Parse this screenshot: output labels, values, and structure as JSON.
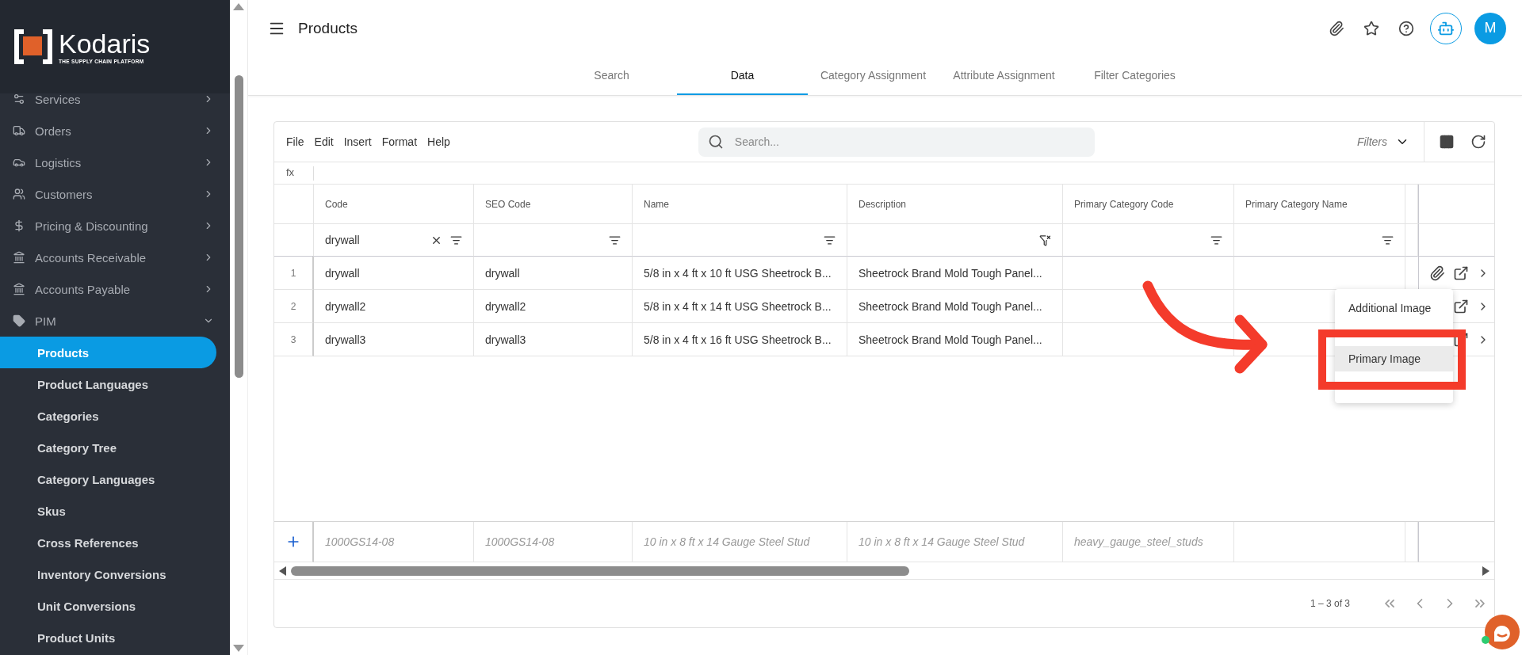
{
  "sidebar": {
    "logo": {
      "name": "Kodaris",
      "tagline": "THE SUPPLY CHAIN PLATFORM"
    },
    "items": [
      {
        "label": "Services",
        "expanded": false
      },
      {
        "label": "Orders",
        "expanded": false
      },
      {
        "label": "Logistics",
        "expanded": false
      },
      {
        "label": "Customers",
        "expanded": false
      },
      {
        "label": "Pricing & Discounting",
        "expanded": false
      },
      {
        "label": "Accounts Receivable",
        "expanded": false
      },
      {
        "label": "Accounts Payable",
        "expanded": false
      },
      {
        "label": "PIM",
        "expanded": true,
        "children": [
          {
            "label": "Products",
            "selected": true
          },
          {
            "label": "Product Languages",
            "selected": false
          },
          {
            "label": "Categories",
            "selected": false
          },
          {
            "label": "Category Tree",
            "selected": false
          },
          {
            "label": "Category Languages",
            "selected": false
          },
          {
            "label": "Skus",
            "selected": false
          },
          {
            "label": "Cross References",
            "selected": false
          },
          {
            "label": "Inventory Conversions",
            "selected": false
          },
          {
            "label": "Unit Conversions",
            "selected": false
          },
          {
            "label": "Product Units",
            "selected": false
          }
        ]
      }
    ]
  },
  "header": {
    "title": "Products",
    "avatar": "M"
  },
  "tabs": [
    {
      "label": "Search",
      "selected": false
    },
    {
      "label": "Data",
      "selected": true
    },
    {
      "label": "Category Assignment",
      "selected": false
    },
    {
      "label": "Attribute Assignment",
      "selected": false
    },
    {
      "label": "Filter Categories",
      "selected": false
    }
  ],
  "menu_bar": [
    "File",
    "Edit",
    "Insert",
    "Format",
    "Help"
  ],
  "search": {
    "placeholder": "Search..."
  },
  "filters_label": "Filters",
  "formula_label": "fx",
  "table": {
    "columns": [
      {
        "label": "Code",
        "filter": "drywall",
        "filter_disabled": false
      },
      {
        "label": "SEO Code",
        "filter_disabled": false
      },
      {
        "label": "Name",
        "filter_disabled": false
      },
      {
        "label": "Description",
        "filter_disabled": true
      },
      {
        "label": "Primary Category Code",
        "filter_disabled": false
      },
      {
        "label": "Primary Category Name",
        "filter_disabled": false
      }
    ],
    "rows": [
      {
        "number": "1",
        "attachment": true,
        "cells": [
          "drywall",
          "drywall",
          "5/8 in x 4 ft x 10 ft USG Sheetrock B...",
          "Sheetrock Brand Mold Tough Panel..."
        ]
      },
      {
        "number": "2",
        "cells": [
          "drywall2",
          "drywall2",
          "5/8 in x 4 ft x 14 ft USG Sheetrock B...",
          "Sheetrock Brand Mold Tough Panel..."
        ]
      },
      {
        "number": "3",
        "cells": [
          "drywall3",
          "drywall3",
          "5/8 in x 4 ft x 16 ft USG Sheetrock B...",
          "Sheetrock Brand Mold Tough Panel..."
        ]
      }
    ],
    "new_row": {
      "cells": [
        "1000GS14-08",
        "1000GS14-08",
        "10 in x 8 ft x 14 Gauge Steel Stud",
        "10 in x 8 ft x 14 Gauge Steel Stud",
        "heavy_gauge_steel_studs"
      ]
    }
  },
  "pagination": {
    "range": "1 – 3 of 3"
  },
  "context_menu": {
    "items": [
      {
        "label": "Additional Image",
        "selected": false
      },
      {
        "label": "Primary Image",
        "selected": true
      }
    ]
  }
}
